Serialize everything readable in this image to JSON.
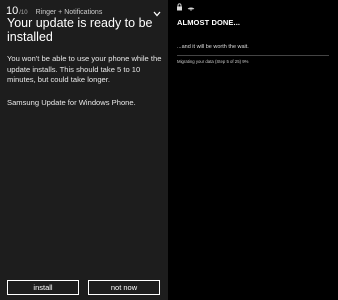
{
  "left_panel": {
    "volume": {
      "value": "10",
      "max": "/10"
    },
    "ringer_label": "Ringer + Notifications",
    "title": "Your update is ready to be installed",
    "description": "You won't be able to use your phone while the update installs. This should take 5 to 10 minutes, but could take longer.",
    "footer": "Samsung Update for Windows Phone.",
    "buttons": {
      "install": "install",
      "not_now": "not now"
    }
  },
  "right_panel": {
    "heading": "ALMOST DONE...",
    "subtext": "...and it will be worth the wait.",
    "progress_text": "Migrating your data (Step 5 of 25) 9%",
    "status_icons": [
      "lock-icon",
      "wifi-icon"
    ]
  },
  "colors": {
    "left_bg": "#1d1d1d",
    "right_bg": "#000000",
    "text": "#ffffff"
  }
}
